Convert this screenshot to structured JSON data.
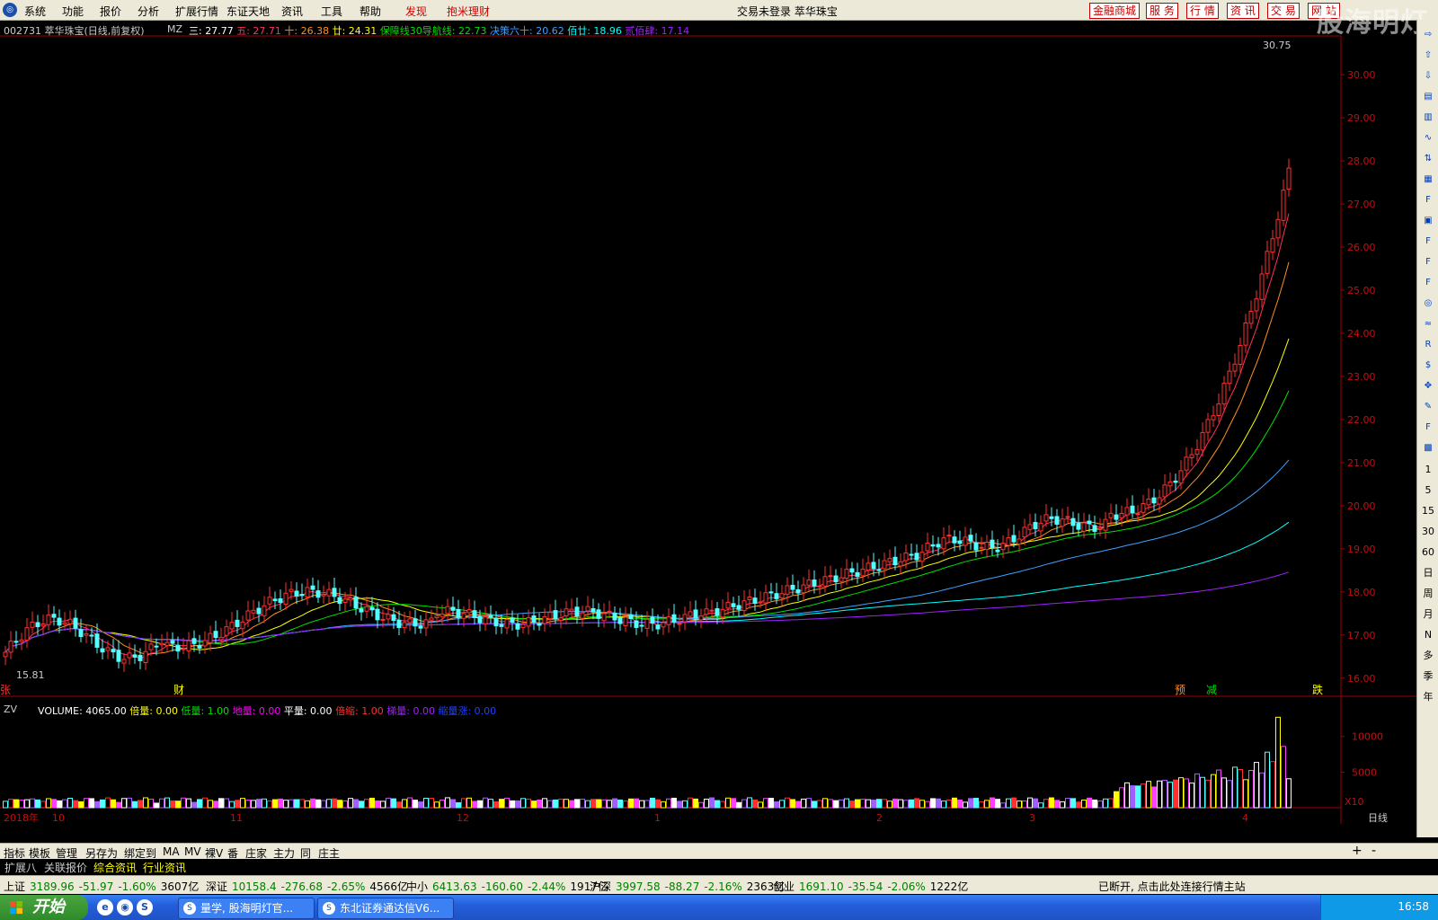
{
  "menubar": {
    "items": [
      "系统",
      "功能",
      "报价",
      "分析",
      "扩展行情",
      "东证天地",
      "资讯",
      "工具",
      "帮助"
    ],
    "red_items": [
      "发现",
      "抱米理财"
    ],
    "title": "交易未登录  萃华珠宝",
    "right_buttons": [
      "金融商城",
      "服 务",
      "行 情",
      "资 讯",
      "交 易",
      "网 站"
    ],
    "watermark": "股海明灯"
  },
  "chart_header": {
    "code_name": "002731 萃华珠宝(日线,前复权)",
    "indicator": "MZ",
    "ma_items": [
      {
        "label": "三: 27.77",
        "color": "#ffffff"
      },
      {
        "label": "五: 27.71",
        "color": "#ff3060"
      },
      {
        "label": "十: 26.38",
        "color": "#ff9020"
      },
      {
        "label": "廿: 24.31",
        "color": "#ffff00"
      },
      {
        "label": "保障线30导航线: 22.73",
        "color": "#00e000"
      },
      {
        "label": "决策六十: 20.62",
        "color": "#40a0ff"
      },
      {
        "label": "佰廿: 18.96",
        "color": "#00ffff"
      },
      {
        "label": "贰佰肆: 17.14",
        "color": "#a020ff"
      }
    ]
  },
  "chart_data": {
    "type": "candlestick",
    "y_axis_ticks": [
      "30.00",
      "29.00",
      "28.00",
      "27.00",
      "26.00",
      "25.00",
      "24.00",
      "23.00",
      "22.00",
      "21.00",
      "20.00",
      "19.00",
      "18.00",
      "17.00",
      "16.00"
    ],
    "ylim": [
      15.6,
      30.9
    ],
    "high_label": "30.75",
    "low_label": "15.81",
    "x_labels": [
      "2018年",
      "10",
      "11",
      "12",
      "1",
      "2",
      "3",
      "4"
    ],
    "markers": [
      "张",
      "财",
      "预",
      "减",
      "跌"
    ],
    "volume": {
      "label": "ZV",
      "header": [
        {
          "label": "VOLUME: 4065.00",
          "color": "#ffffff"
        },
        {
          "label": "倍量: 0.00",
          "color": "#ffff00"
        },
        {
          "label": "低量: 1.00",
          "color": "#00e000"
        },
        {
          "label": "地量: 0.00",
          "color": "#ff00ff"
        },
        {
          "label": "平量: 0.00",
          "color": "#ffffff"
        },
        {
          "label": "倍缩: 1.00",
          "color": "#ff3030"
        },
        {
          "label": "梯量: 0.00",
          "color": "#a020ff"
        },
        {
          "label": "缩量涨: 0.00",
          "color": "#2040ff"
        }
      ],
      "y_ticks": [
        "10000",
        "5000"
      ],
      "unit": "X10"
    },
    "period": "日线"
  },
  "bottom_tabs": [
    "指标",
    "模板",
    "管理",
    "另存为",
    "绑定到",
    "MA",
    "MV",
    "裸V",
    "番",
    "庄家",
    "主力",
    "同",
    "庄主"
  ],
  "info_tabs": [
    "扩展八",
    "关联报价",
    "综合资讯",
    "行业资讯"
  ],
  "status": {
    "sh": {
      "name": "上证",
      "value": "3189.96",
      "chg": "-51.97",
      "pct": "-1.60%",
      "amt": "3607亿"
    },
    "sz": {
      "name": "深证",
      "value": "10158.4",
      "chg": "-276.68",
      "pct": "-2.65%",
      "amt": "4566亿"
    },
    "zx": {
      "name": "中小",
      "value": "6413.63",
      "chg": "-160.60",
      "pct": "-2.44%",
      "amt": "1917亿"
    },
    "hs": {
      "name": "沪深",
      "value": "3997.58",
      "chg": "-88.27",
      "pct": "-2.16%",
      "amt": "2363亿"
    },
    "cy": {
      "name": "创业",
      "value": "1691.10",
      "chg": "-35.54",
      "pct": "-2.06%",
      "amt": "1222亿"
    },
    "message": "已断开, 点击此处连接行情主站"
  },
  "taskbar": {
    "start": "开始",
    "tasks": [
      "量学, 股海明灯官...",
      "东北证券通达信V6..."
    ],
    "time": "16:58"
  },
  "right_toolbar": [
    "1",
    "5",
    "15",
    "30",
    "60",
    "日",
    "周",
    "月",
    "N",
    "多",
    "季",
    "年"
  ]
}
